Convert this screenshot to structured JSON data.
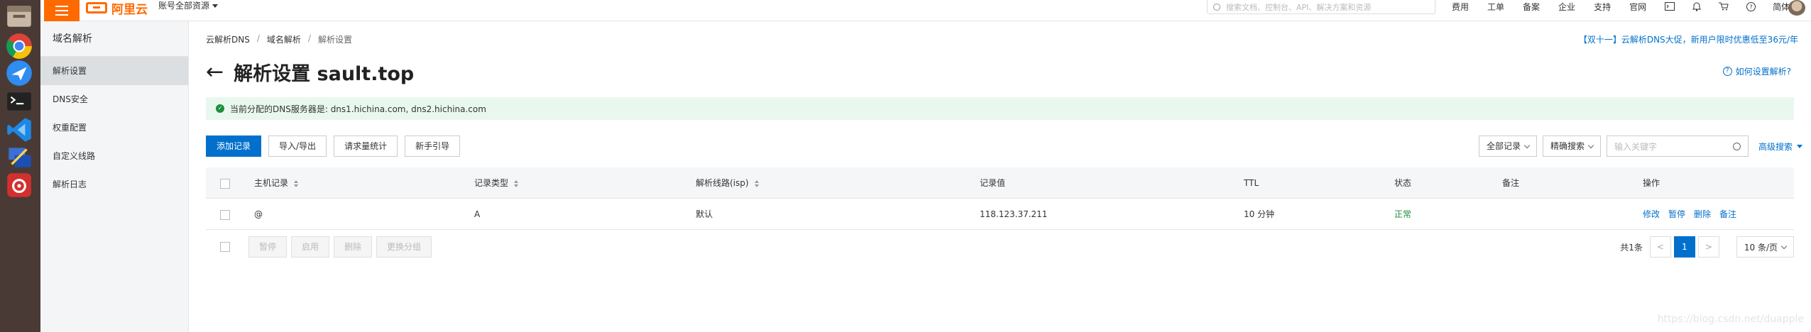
{
  "topbar": {
    "logo_text": "阿里云",
    "account_select": "账号全部资源",
    "search_placeholder": "搜索文档、控制台、API、解决方案和资源",
    "nav": [
      "费用",
      "工单",
      "备案",
      "企业",
      "支持",
      "官网"
    ],
    "lang": "简体"
  },
  "sidenav": {
    "title": "域名解析",
    "items": [
      {
        "label": "解析设置",
        "active": true
      },
      {
        "label": "DNS安全"
      },
      {
        "label": "权重配置"
      },
      {
        "label": "自定义线路"
      },
      {
        "label": "解析日志"
      }
    ]
  },
  "breadcrumb": [
    "云解析DNS",
    "域名解析",
    "解析设置"
  ],
  "promo": "【双十一】云解析DNS大促，新用户限时优惠低至36元/年",
  "page": {
    "title": "解析设置 sault.top",
    "help": "如何设置解析?"
  },
  "notice": "当前分配的DNS服务器是: dns1.hichina.com, dns2.hichina.com",
  "toolbar": {
    "add": "添加记录",
    "import_export": "导入/导出",
    "stats": "请求量统计",
    "guide": "新手引导"
  },
  "filters": {
    "all_records": "全部记录",
    "exact_search": "精确搜索",
    "keyword_placeholder": "输入关键字",
    "advanced": "高级搜索"
  },
  "table": {
    "headers": {
      "host": "主机记录",
      "type": "记录类型",
      "line": "解析线路(isp)",
      "value": "记录值",
      "ttl": "TTL",
      "status": "状态",
      "remark": "备注",
      "ops": "操作"
    },
    "rows": [
      {
        "host": "@",
        "type": "A",
        "line": "默认",
        "value": "118.123.37.211",
        "ttl": "10 分钟",
        "status": "正常",
        "remark": "",
        "actions": [
          "修改",
          "暂停",
          "删除",
          "备注"
        ]
      }
    ]
  },
  "bulk_actions": [
    "暂停",
    "启用",
    "删除",
    "更换分组"
  ],
  "pagination": {
    "total": "共1条",
    "current_page": "1",
    "page_size": "10 条/页"
  },
  "watermark": "https://blog.csdn.net/duapple"
}
